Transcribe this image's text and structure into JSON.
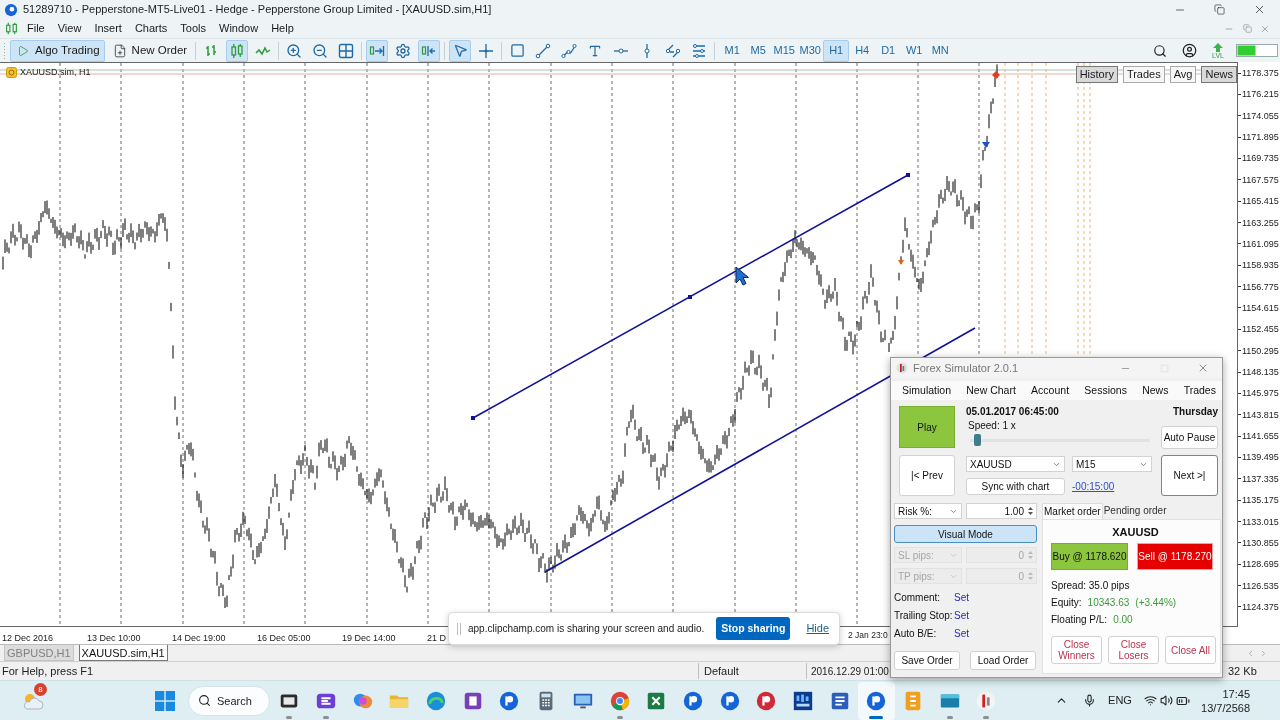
{
  "window": {
    "title": "51289710 - Pepperstone-MT5-Live01 - Hedge - Pepperstone Group Limited - [XAUUSD.sim,H1]"
  },
  "menu": [
    "File",
    "View",
    "Insert",
    "Charts",
    "Tools",
    "Window",
    "Help"
  ],
  "toolbar": {
    "algo_trading": {
      "label": "Algo Trading",
      "on": true
    },
    "new_order": {
      "label": "New Order"
    },
    "chart_types": [
      {
        "selected": false
      },
      {
        "selected": true
      },
      {
        "selected": false
      }
    ],
    "auto_scroll": {
      "on": true
    },
    "chart_shift": {
      "on": true
    },
    "pointer_tools": [
      {
        "selected": true
      },
      {
        "selected": false
      }
    ],
    "timeframes": [
      {
        "label": "M1",
        "selected": false
      },
      {
        "label": "M5",
        "selected": false
      },
      {
        "label": "M15",
        "selected": false
      },
      {
        "label": "M30",
        "selected": false
      },
      {
        "label": "H1",
        "selected": true
      },
      {
        "label": "H4",
        "selected": false
      },
      {
        "label": "D1",
        "selected": false
      },
      {
        "label": "W1",
        "selected": false
      },
      {
        "label": "MN",
        "selected": false
      }
    ],
    "level_label": "LVL"
  },
  "chart": {
    "symbol_label": "XAUUSD.sim, H1",
    "panel_buttons": [
      {
        "label": "History",
        "selected": true
      },
      {
        "label": "Trades",
        "selected": false
      },
      {
        "label": "Avg",
        "selected": false
      },
      {
        "label": "News",
        "selected": true
      }
    ],
    "price_axis": [
      "1178.375",
      "1176.215",
      "1174.055",
      "1171.895",
      "1169.735",
      "1167.575",
      "1165.415",
      "1163.255",
      "1161.095",
      "1158.935",
      "1156.775",
      "1154.615",
      "1152.455",
      "1150.295",
      "1148.135",
      "1145.975",
      "1143.815",
      "1141.655",
      "1139.495",
      "1137.335",
      "1135.175",
      "1133.015",
      "1130.855",
      "1128.695",
      "1126.535",
      "1124.375"
    ],
    "time_axis": [
      "12 Dec 2016",
      "13 Dec 10:00",
      "14 Dec 19:00",
      "16 Dec 05:00",
      "19 Dec 14:00",
      "21 D",
      "2 Jan 23:0"
    ]
  },
  "chart_tabs": [
    {
      "label": "GBPUSD,H1",
      "selected": false
    },
    {
      "label": "XAUUSD.sim,H1",
      "selected": true
    }
  ],
  "status_bar": {
    "help": "For Help, press F1",
    "profile": "Default",
    "time": "2016.12.29 01:00",
    "traffic": "32 Kb"
  },
  "screen_share": {
    "message": "app.clipchamp.com is sharing your screen and audio.",
    "stop_button": "Stop sharing",
    "hide_link": "Hide"
  },
  "simulator": {
    "title": "Forex Simulator 2.0.1",
    "menu": [
      "Simulation",
      "New Chart",
      "Account",
      "Sessions",
      "News",
      "Trades"
    ],
    "play_button": "Play",
    "datetime": "05.01.2017 06:45:00",
    "weekday": "Thursday",
    "speed": {
      "label": "Speed: 1 x",
      "level": 0.02
    },
    "auto_pause_button": "Auto Pause",
    "prev_button": "|< Prev",
    "next_button": "Next >|",
    "symbol_select": "XAUUSD",
    "timeframe_select": "M15",
    "sync_button": "Sync with chart",
    "step_link": "-00:15:00",
    "risk": {
      "label": "Risk %:",
      "value": "1.00"
    },
    "visual_mode": {
      "label": "Visual Mode",
      "on": true
    },
    "sl": {
      "label": "SL pips:",
      "value": "0",
      "disabled": true
    },
    "tp": {
      "label": "TP pips:",
      "value": "0",
      "disabled": true
    },
    "settings": [
      {
        "label": "Comment:",
        "action": "Set"
      },
      {
        "label": "Trailing Stop:",
        "action": "Set"
      },
      {
        "label": "Auto B/E:",
        "action": "Set"
      }
    ],
    "save_button": "Save Order",
    "load_button": "Load Order",
    "order_tabs": [
      {
        "label": "Market order",
        "selected": true
      },
      {
        "label": "Pending order",
        "selected": false
      }
    ],
    "symbol": "XAUUSD",
    "buy_button": "Buy @ 1178.620",
    "sell_button": "Sell @ 1178.270",
    "spread": "Spread: 35.0 pips",
    "equity": {
      "label": "Equity:",
      "value": "10343.63",
      "change": "(+3.44%)"
    },
    "floating": {
      "label": "Floating P/L:",
      "value": "0.00"
    },
    "close_buttons": [
      "Close Winners",
      "Close Losers",
      "Close All"
    ]
  },
  "taskbar": {
    "weather_badge": "8",
    "search": {
      "placeholder": "Search"
    },
    "apps": [
      {
        "running": true,
        "selected": false
      },
      {
        "running": true,
        "selected": false
      },
      {
        "running": false,
        "selected": false
      },
      {
        "running": false,
        "selected": false
      },
      {
        "running": false,
        "selected": false
      },
      {
        "running": false,
        "selected": false
      },
      {
        "running": false,
        "selected": false
      },
      {
        "running": false,
        "selected": false
      },
      {
        "running": false,
        "selected": false
      },
      {
        "running": true,
        "selected": false
      },
      {
        "running": false,
        "selected": false
      },
      {
        "running": false,
        "selected": false
      },
      {
        "running": false,
        "selected": false
      },
      {
        "running": false,
        "selected": false
      },
      {
        "running": false,
        "selected": false
      },
      {
        "running": false,
        "selected": false
      },
      {
        "running": true,
        "selected": true
      },
      {
        "running": false,
        "selected": false
      },
      {
        "running": true,
        "selected": false
      },
      {
        "running": true,
        "selected": false
      }
    ],
    "language": "ENG",
    "time": "17:45",
    "date": "13/7/2568"
  }
}
